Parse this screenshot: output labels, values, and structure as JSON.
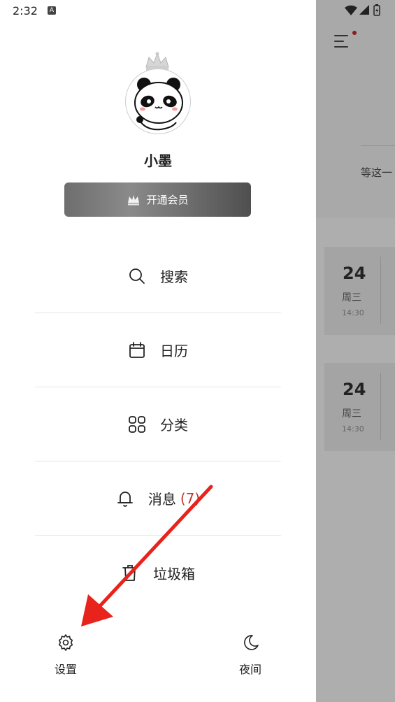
{
  "status_bar": {
    "time": "2:32",
    "notification_letter": "A"
  },
  "profile": {
    "username": "小墨",
    "vip_button_label": "开通会员"
  },
  "menu": {
    "items": [
      {
        "label": "搜索",
        "icon": "search-icon"
      },
      {
        "label": "日历",
        "icon": "calendar-icon"
      },
      {
        "label": "分类",
        "icon": "grid-icon"
      },
      {
        "label": "消息",
        "icon": "bell-icon",
        "badge": "(7)"
      },
      {
        "label": "垃圾箱",
        "icon": "trash-icon"
      }
    ]
  },
  "bottom": {
    "settings_label": "设置",
    "night_label": "夜间"
  },
  "background_app": {
    "motto": "等这一",
    "cards": [
      {
        "day": "24",
        "weekday": "周三",
        "time": "14:30"
      },
      {
        "day": "24",
        "weekday": "周三",
        "time": "14:30"
      }
    ]
  },
  "colors": {
    "badge": "#c0392b",
    "annotation_arrow": "#e8231c",
    "scrim": "#aeaeae"
  }
}
